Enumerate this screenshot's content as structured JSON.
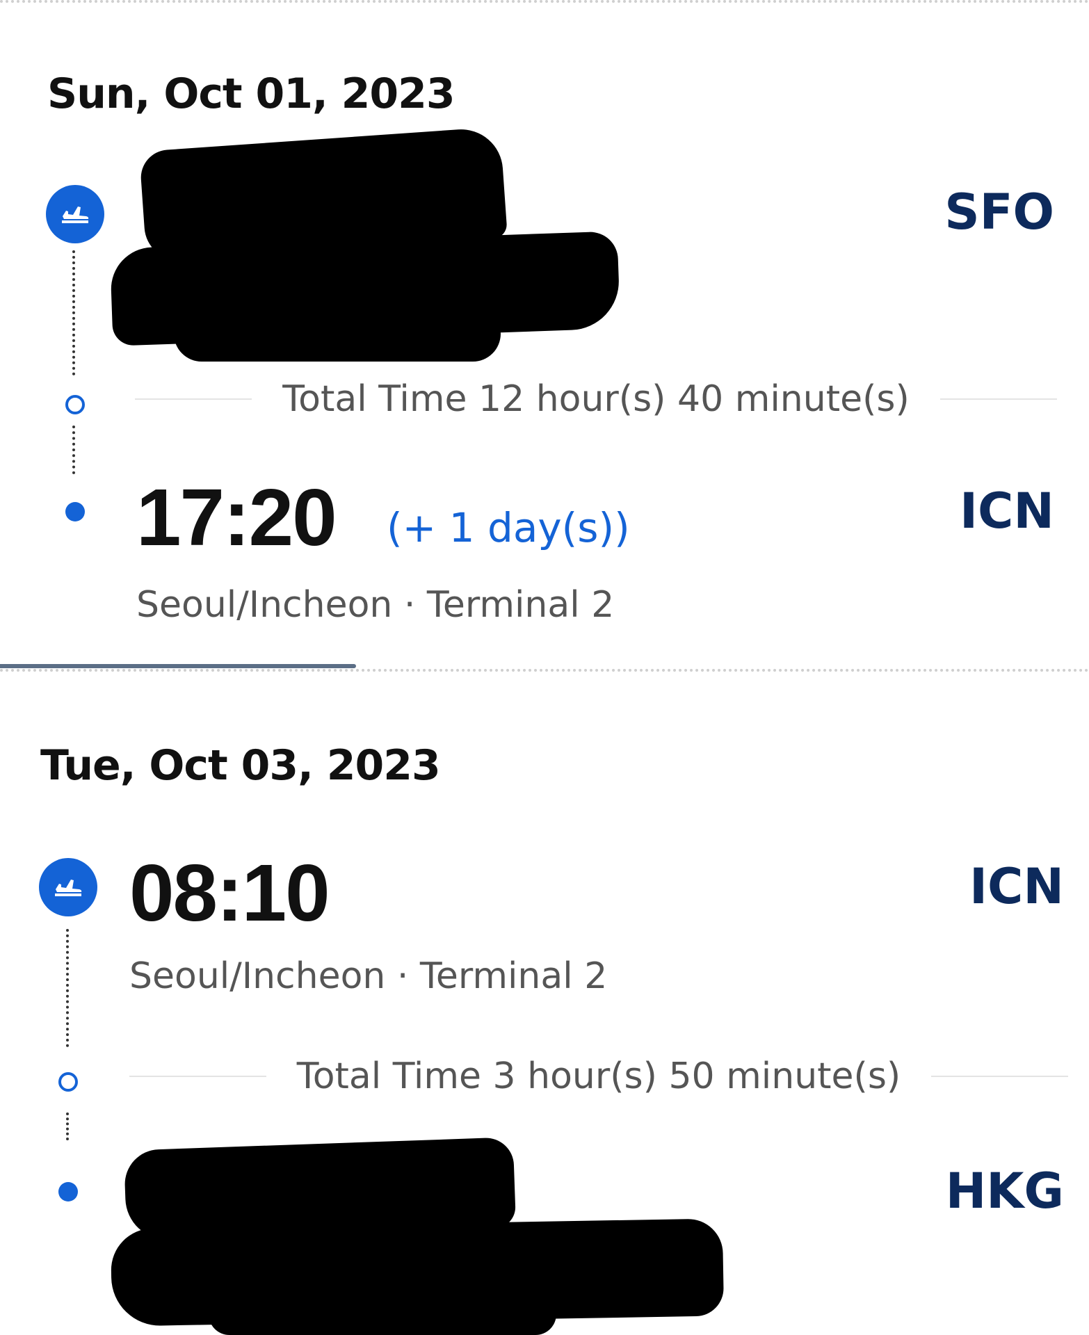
{
  "segments": [
    {
      "date": "Sun, Oct 01, 2023",
      "departure": {
        "time": "",
        "airport_info": "",
        "code": "SFO"
      },
      "duration": "Total Time 12 hour(s) 40 minute(s)",
      "arrival": {
        "time": "17:20",
        "day_offset": "(+ 1 day(s))",
        "airport_info": "Seoul/Incheon · Terminal 2",
        "code": "ICN"
      }
    },
    {
      "date": "Tue, Oct 03, 2023",
      "departure": {
        "time": "08:10",
        "airport_info": "Seoul/Incheon · Terminal 2",
        "code": "ICN"
      },
      "duration": "Total Time 3 hour(s) 50 minute(s)",
      "arrival": {
        "time": "",
        "airport_info": "",
        "code": "HKG"
      }
    }
  ],
  "colors": {
    "accent_blue": "#1463d6",
    "code_navy": "#0d2a5c",
    "secondary_text": "#555555"
  },
  "icons": {
    "departure_badge": "plane-takeoff-icon",
    "stop_marker": "hollow-circle",
    "arrival_marker": "solid-circle"
  }
}
